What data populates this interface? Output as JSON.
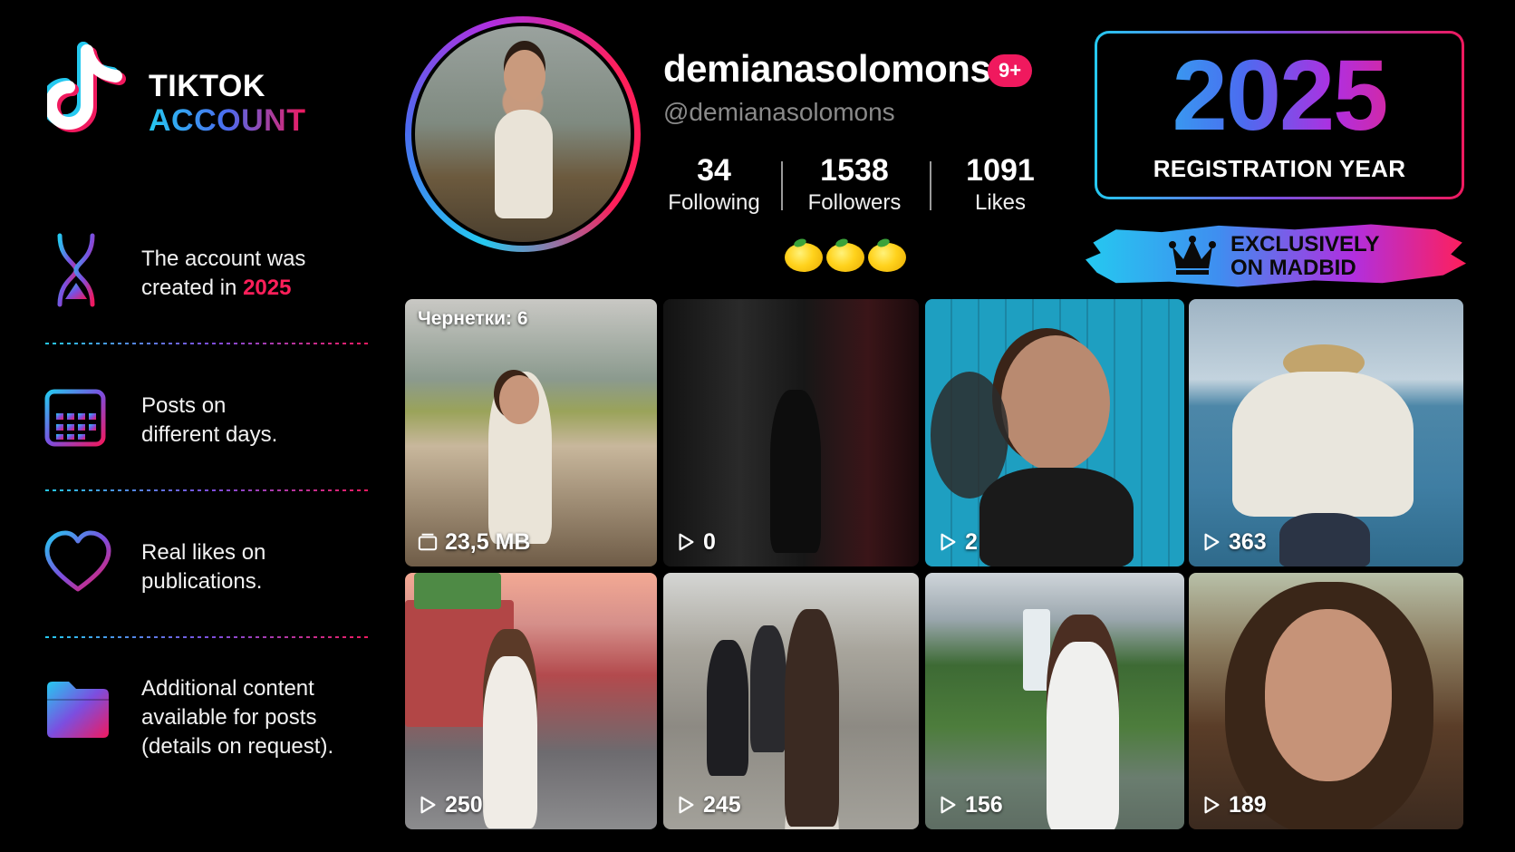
{
  "brand": {
    "title_line1": "TIKTOK",
    "title_line2": "ACCOUNT"
  },
  "features": [
    {
      "icon": "hourglass-icon",
      "text_before": "The account was created in ",
      "highlight": "2025",
      "text_after": ""
    },
    {
      "icon": "calendar-icon",
      "text_before": "Posts on different days.",
      "highlight": "",
      "text_after": ""
    },
    {
      "icon": "heart-icon",
      "text_before": "Real likes on publications.",
      "highlight": "",
      "text_after": ""
    },
    {
      "icon": "folder-icon",
      "text_before": "Additional content available for posts (details on request).",
      "highlight": "",
      "text_after": ""
    }
  ],
  "profile": {
    "username": "demianasolomons",
    "notification_badge": "9+",
    "handle": "@demianasolomons",
    "stats": [
      {
        "value": "34",
        "label": "Following"
      },
      {
        "value": "1538",
        "label": "Followers"
      },
      {
        "value": "1091",
        "label": "Likes"
      }
    ],
    "emoji": "🍋🍋🍋"
  },
  "registration": {
    "year": "2025",
    "label": "REGISTRATION YEAR"
  },
  "exclusive": {
    "line1": "EXCLUSIVELY",
    "line2": "ON MADBID"
  },
  "grid": {
    "drafts_label": "Чернетки: 6",
    "tiles": [
      {
        "type": "drafts",
        "value": "23,5 MB"
      },
      {
        "type": "video",
        "value": "0"
      },
      {
        "type": "video",
        "value": "2"
      },
      {
        "type": "video",
        "value": "363"
      },
      {
        "type": "video",
        "value": "250"
      },
      {
        "type": "video",
        "value": "245"
      },
      {
        "type": "video",
        "value": "156"
      },
      {
        "type": "video",
        "value": "189"
      }
    ]
  },
  "colors": {
    "accent_cyan": "#25c9f0",
    "accent_pink": "#f0195e",
    "accent_purple": "#7b4fe0",
    "background": "#000000"
  }
}
